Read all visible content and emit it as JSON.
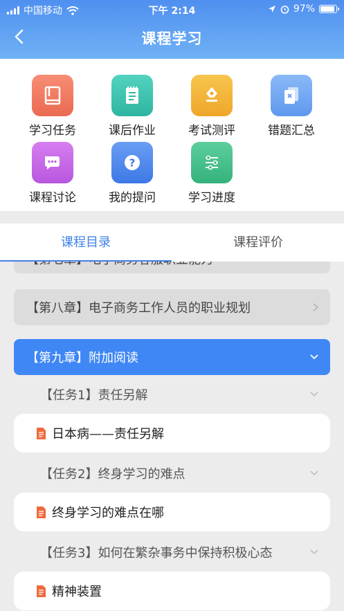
{
  "status_bar": {
    "carrier": "中国移动",
    "time": "下午 2:14",
    "battery": "97%",
    "battery_level": 0.97
  },
  "header": {
    "title": "课程学习"
  },
  "grid": [
    {
      "label": "学习任务",
      "icon": "book-icon",
      "color": "#f07a62"
    },
    {
      "label": "课后作业",
      "icon": "notepad-icon",
      "color": "#3ec3b0"
    },
    {
      "label": "考试测评",
      "icon": "pen-nib-icon",
      "color": "#f4b63a"
    },
    {
      "label": "错题汇总",
      "icon": "wrong-doc-icon",
      "color": "#72a8f4"
    },
    {
      "label": "课程讨论",
      "icon": "chat-bubbles-icon",
      "color": "#c766e8"
    },
    {
      "label": "我的提问",
      "icon": "question-icon",
      "color": "#4d88ec"
    },
    {
      "label": "学习进度",
      "icon": "sliders-icon",
      "color": "#43c08a"
    }
  ],
  "tabs": [
    {
      "label": "课程目录",
      "active": true
    },
    {
      "label": "课程评价",
      "active": false
    }
  ],
  "list": {
    "partial_chapter": "【第七章】电子商务客服职业能力",
    "chapter8": "【第八章】电子商务工作人员的职业规划",
    "chapter9": "【第九章】附加阅读",
    "task1": "【任务1】责任另解",
    "item1": "日本病——责任另解",
    "task2": "【任务2】终身学习的难点",
    "item2": "终身学习的难点在哪",
    "task3": "【任务3】如何在繁杂事务中保持积极心态",
    "item3": "精神装置"
  }
}
